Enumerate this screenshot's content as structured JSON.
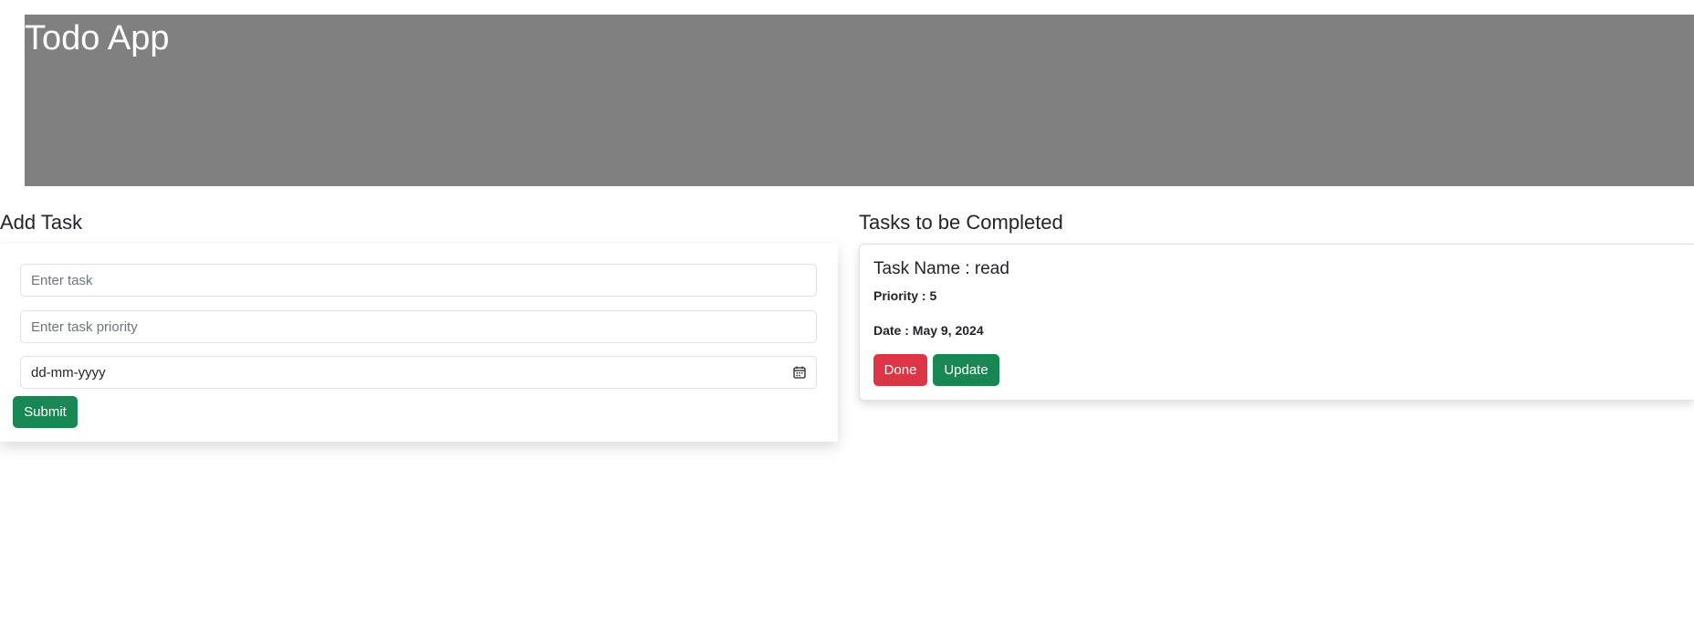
{
  "header": {
    "title": "Todo App"
  },
  "add_task": {
    "heading": "Add Task",
    "task_input": {
      "placeholder": "Enter task",
      "value": ""
    },
    "priority_input": {
      "placeholder": "Enter task priority",
      "value": ""
    },
    "date_input": {
      "value": "dd-mm-yyyy",
      "icon": "calendar-icon"
    },
    "submit_label": "Submit"
  },
  "tasks": {
    "heading": "Tasks to be Completed",
    "items": [
      {
        "name_text": "Task Name : read",
        "priority_text": "Priority : 5",
        "date_text": "Date : May 9, 2024",
        "done_label": "Done",
        "update_label": "Update"
      }
    ]
  },
  "colors": {
    "banner": "#808080",
    "success": "#198754",
    "danger": "#dc3545"
  }
}
